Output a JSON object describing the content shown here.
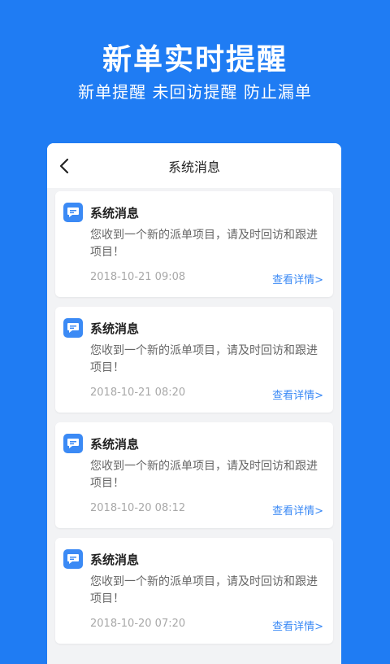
{
  "promo": {
    "title": "新单实时提醒",
    "subtitle": "新单提醒  未回访提醒  防止漏单"
  },
  "topbar": {
    "back_icon": "chevron-left-icon",
    "title": "系统消息"
  },
  "messages": [
    {
      "icon": "message-icon",
      "title": "系统消息",
      "body": "您收到一个新的派单项目，请及时回访和跟进项目！",
      "time": "2018-10-21 09:08",
      "link": "查看详情>"
    },
    {
      "icon": "message-icon",
      "title": "系统消息",
      "body": "您收到一个新的派单项目，请及时回访和跟进项目！",
      "time": "2018-10-21 08:20",
      "link": "查看详情>"
    },
    {
      "icon": "message-icon",
      "title": "系统消息",
      "body": "您收到一个新的派单项目，请及时回访和跟进项目！",
      "time": "2018-10-20 08:12",
      "link": "查看详情>"
    },
    {
      "icon": "message-icon",
      "title": "系统消息",
      "body": "您收到一个新的派单项目，请及时回访和跟进项目！",
      "time": "2018-10-20 07:20",
      "link": "查看详情>"
    }
  ],
  "colors": {
    "background": "#1f7cf3",
    "accent": "#3b8af5",
    "card_bg": "#ffffff",
    "list_bg": "#f2f3f5"
  }
}
